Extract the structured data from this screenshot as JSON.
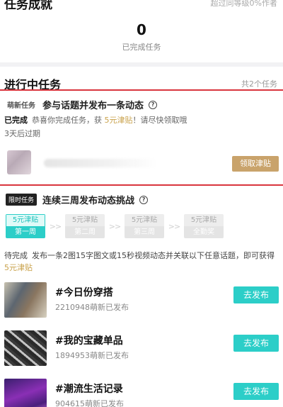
{
  "achievements": {
    "title": "任务成就",
    "rank_text": "超过同等级0%作者",
    "completed_count": "0",
    "completed_label": "已完成任务"
  },
  "in_progress": {
    "title": "进行中任务",
    "count_text": "共2个任务"
  },
  "task1": {
    "tag": "萌新任务",
    "title": "参与话题并发布一条动态",
    "status_done": "已完成",
    "status_text_a": "恭喜你完成任务，获",
    "reward": "5元津贴",
    "status_text_b": "！请尽快领取哦",
    "expire": "3天后过期",
    "claim_label": "领取津贴"
  },
  "task2": {
    "tag": "限时任务",
    "title": "连续三周发布动态挑战",
    "steps": [
      {
        "reward": "5元津贴",
        "label": "第一周"
      },
      {
        "reward": "5元津贴",
        "label": "第二周"
      },
      {
        "reward": "5元津贴",
        "label": "第三周"
      },
      {
        "reward": "5元津贴",
        "label": "全勤奖"
      }
    ],
    "arrow": ">>",
    "pending": "待完成",
    "desc": "发布一条2图15字图文或15秒视频动态并关联以下任意话题，即可获得",
    "desc_reward": "5元津贴"
  },
  "topics": [
    {
      "name": "#今日份穿搭",
      "count": "2210948萌新已发布",
      "button": "去发布"
    },
    {
      "name": "#我的宝藏单品",
      "count": "1894953萌新已发布",
      "button": "去发布"
    },
    {
      "name": "#潮流生活记录",
      "count": "904615萌新已发布",
      "button": "去发布"
    }
  ],
  "colors": {
    "teal": "#2ccec8",
    "gold": "#c9a36b",
    "red_border": "#d9363e"
  }
}
